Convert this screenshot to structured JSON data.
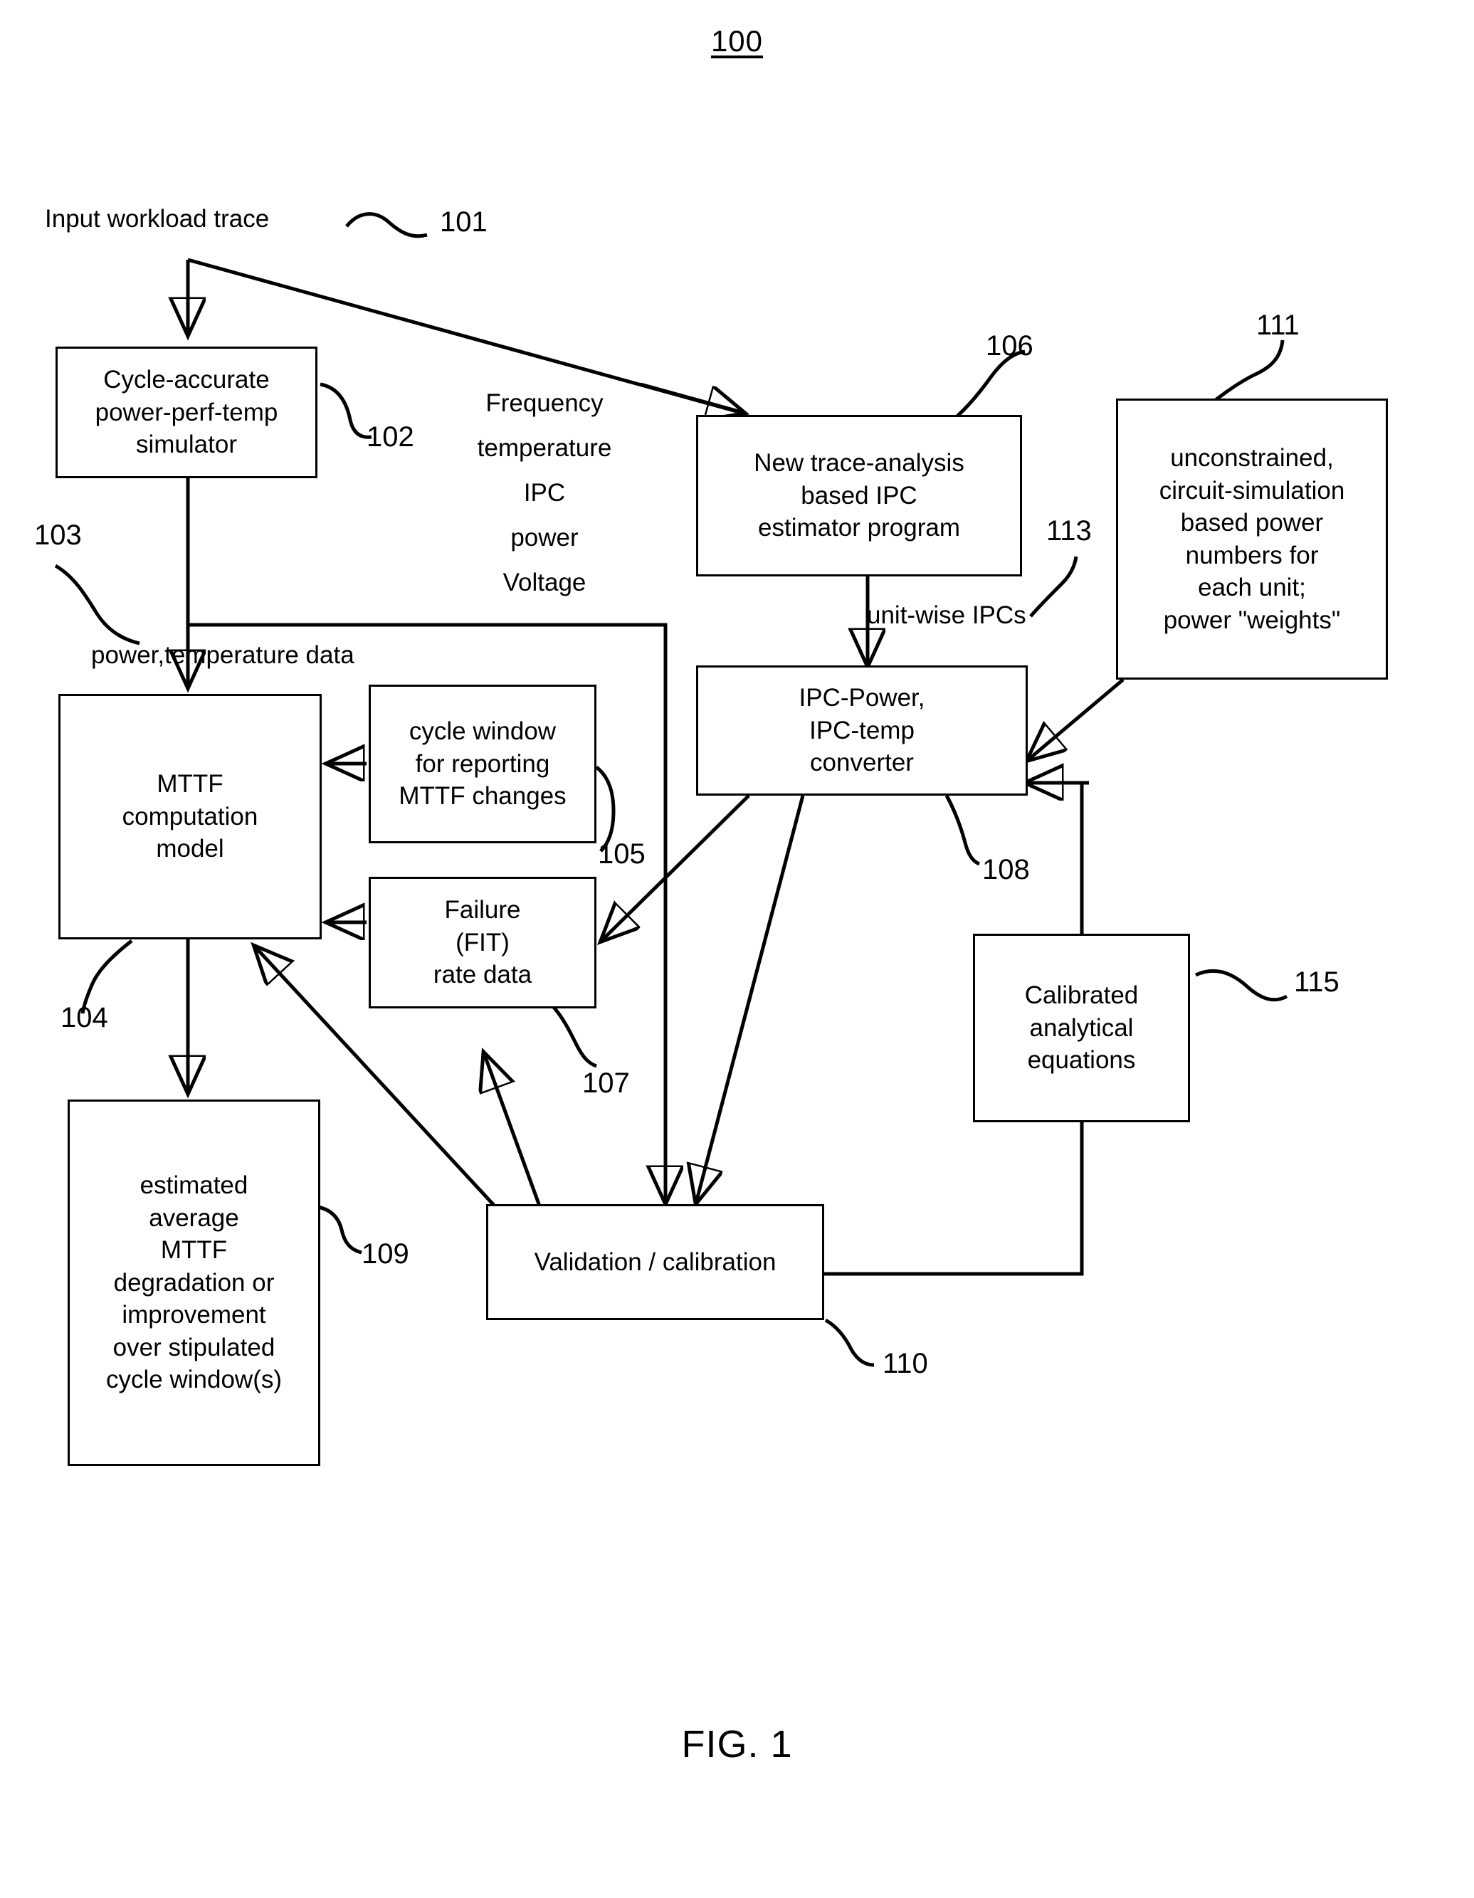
{
  "figure": {
    "number_label": "100",
    "caption": "FIG. 1"
  },
  "nodes": {
    "simulator": {
      "ref": "102",
      "lines": [
        "Cycle-accurate",
        "power-perf-temp",
        "simulator"
      ]
    },
    "ipc_estimator": {
      "ref": "106",
      "lines": [
        "New trace-analysis",
        "based IPC",
        "estimator program"
      ]
    },
    "power_numbers": {
      "ref": "111",
      "lines": [
        "unconstrained,",
        "circuit-simulation",
        "based power",
        "numbers for",
        "each unit;",
        "power \"weights\""
      ]
    },
    "mttf_model": {
      "ref": "104",
      "lines": [
        "MTTF",
        "computation",
        "model"
      ]
    },
    "cycle_window": {
      "ref": "105",
      "lines": [
        "cycle window",
        "for reporting",
        "MTTF changes"
      ]
    },
    "ipc_converter": {
      "ref": "108",
      "lines": [
        "IPC-Power,",
        "IPC-temp",
        "converter"
      ]
    },
    "fit_rate": {
      "ref": "107",
      "lines": [
        "Failure",
        "(FIT)",
        "rate data"
      ]
    },
    "calibrated_equations": {
      "ref": "115",
      "lines": [
        "Calibrated",
        "analytical",
        "equations"
      ]
    },
    "estimated_mttf": {
      "ref": "109",
      "lines": [
        "estimated",
        "average",
        "MTTF",
        "degradation or",
        "improvement",
        "over stipulated",
        "cycle window(s)"
      ]
    },
    "validation": {
      "ref": "110",
      "lines": [
        "Validation / calibration"
      ]
    }
  },
  "labels": {
    "input_trace": "Input workload trace",
    "input_trace_ref": "101",
    "signal_list": [
      "Frequency",
      "temperature",
      "IPC",
      "power",
      "Voltage"
    ],
    "power_temp_data": "power,temperature data",
    "power_temp_data_ref": "103",
    "unit_wise_ipcs": "unit-wise IPCs",
    "unit_wise_ipcs_ref": "113"
  },
  "colors": {
    "ink": "#000000",
    "paper": "#ffffff"
  }
}
